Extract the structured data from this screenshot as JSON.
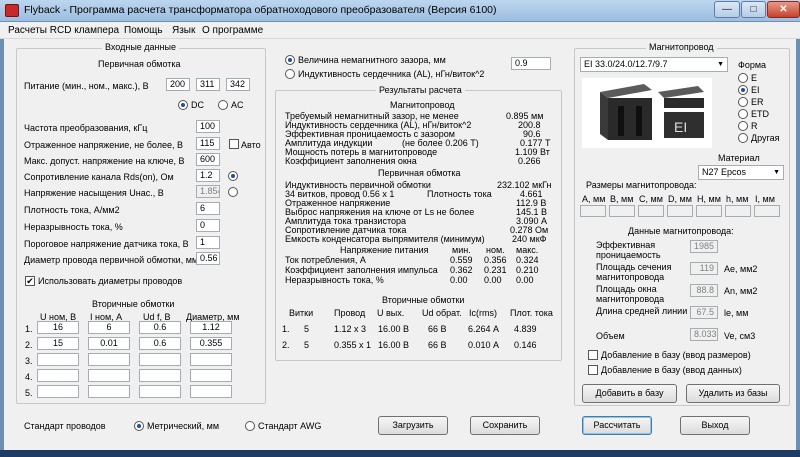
{
  "window": {
    "title": "Flyback - Программа расчета трансформатора обратноходового преобразователя (Версия 6100)",
    "min": "—",
    "max": "□",
    "close": "✕"
  },
  "menu": [
    "Расчеты RCD клампера",
    "Помощь",
    "Язык",
    "О программе"
  ],
  "input": {
    "title": "Входные данные",
    "primary_title": "Первичная обмотка",
    "supply_label": "Питание (мин., ном., макс.), В",
    "supply": [
      "200",
      "311",
      "342"
    ],
    "dc": "DC",
    "ac": "AC",
    "params": [
      {
        "label": "Частота преобразования, кГц",
        "value": "100"
      },
      {
        "label": "Отраженное напряжение, не более, В",
        "value": "115"
      },
      {
        "label": "Макс. допуст. напряжение на ключе, В",
        "value": "600"
      },
      {
        "label": "Сопротивление канала Rds(on), Ом",
        "value": "1.2"
      },
      {
        "label": "Напряжение насыщения Uнас., В",
        "value": "1.854"
      },
      {
        "label": "Плотность тока, А/мм2",
        "value": "6"
      },
      {
        "label": "Неразрывность тока, %",
        "value": "0"
      },
      {
        "label": "Пороговое напряжение датчика тока, В",
        "value": "1"
      },
      {
        "label": "Диаметр провода первичной обмотки, мм",
        "value": "0.56"
      }
    ],
    "auto": "Авто",
    "use_diam": "Использовать диаметры проводов",
    "secondary_title": "Вторичные обмотки",
    "sec_headers": [
      "U ном, В",
      "I ном, А",
      "Ud f, В",
      "Диаметр, мм"
    ],
    "sec_rows": [
      {
        "n": "1.",
        "v": [
          "16",
          "6",
          "0.6",
          "1.12"
        ]
      },
      {
        "n": "2.",
        "v": [
          "15",
          "0.01",
          "0.6",
          "0.355"
        ]
      },
      {
        "n": "3.",
        "v": [
          "",
          "",
          "",
          ""
        ]
      },
      {
        "n": "4.",
        "v": [
          "",
          "",
          "",
          ""
        ]
      },
      {
        "n": "5.",
        "v": [
          "",
          "",
          "",
          ""
        ]
      }
    ]
  },
  "gap": {
    "opt1": "Величина немагнитного зазора, мм",
    "opt2": "Индуктивность сердечника (AL), нГн/виток^2",
    "value": "0.9"
  },
  "results": {
    "title": "Результаты расчета",
    "core_title": "Магнитопровод",
    "core_rows": [
      [
        "Требуемый немагнитный зазор, не менее",
        "",
        "0.895 мм"
      ],
      [
        "Индуктивность сердечника (AL), нГн/виток^2",
        "",
        "200.8"
      ],
      [
        "Эффективная проницаемость с зазором",
        "",
        "90.6"
      ],
      [
        "Амплитуда индукции",
        "(не более 0.206 Т)",
        "0.177 Т"
      ],
      [
        "Мощность потерь в магнитопроводе",
        "",
        "1.109 Вт"
      ],
      [
        "Коэффициент заполнения окна",
        "",
        "0.266"
      ]
    ],
    "prim_title": "Первичная обмотка",
    "prim_rows": [
      [
        "Индуктивность первичной обмотки",
        "",
        "232.102 мкГн"
      ],
      [
        "  34 витков, провод 0.56 x 1",
        "Плотность тока",
        "4.661"
      ],
      [
        "Отраженное напряжение",
        "",
        "112.9 В"
      ],
      [
        "Выброс напряжения на ключе от Ls не более",
        "",
        "145.1 В"
      ],
      [
        "Амплитуда тока транзистора",
        "",
        "3.090 А"
      ],
      [
        "Сопротивление датчика тока",
        "",
        "0.278 Ом"
      ],
      [
        "Емкость конденсатора выпрямителя (минимум)",
        "",
        "240 мкФ"
      ]
    ],
    "sup_title": "Напряжение питания",
    "sup_cols": [
      "мин.",
      "ном.",
      "макс."
    ],
    "sup_rows": [
      {
        "label": "Ток потребления, А",
        "v": [
          "0.559",
          "0.356",
          "0.324"
        ]
      },
      {
        "label": "Коэффициент заполнения импульса",
        "v": [
          "0.362",
          "0.231",
          "0.210"
        ]
      },
      {
        "label": "Неразрывность тока, %",
        "v": [
          "0.00",
          "0.00",
          "0.00"
        ]
      }
    ],
    "sec_title": "Вторичные обмотки",
    "sec_headers": [
      "Витки",
      "Провод",
      "U вых.",
      "Ud обрат.",
      "Ic(rms)",
      "Плот. тока"
    ],
    "sec_rows": [
      {
        "n": "1.",
        "v": [
          "5",
          "1.12 x 3",
          "16.00 В",
          "66 В",
          "6.264 А",
          "4.839"
        ]
      },
      {
        "n": "2.",
        "v": [
          "5",
          "0.355 x 1",
          "16.00 В",
          "66 В",
          "0.010 А",
          "0.146"
        ]
      }
    ]
  },
  "core": {
    "title": "Магнитопровод",
    "selected": "EI 33.0/24.0/12.7/9.7",
    "shape_title": "Форма",
    "shapes": [
      "E",
      "EI",
      "ER",
      "ETD",
      "R",
      "Другая"
    ],
    "shape_selected": 1,
    "material_title": "Материал",
    "material": "N27 Epcos",
    "dims_title": "Размеры магнитопровода:",
    "dims": [
      "A, мм",
      "B, мм",
      "C, мм",
      "D, мм",
      "H, мм",
      "h, мм",
      "I, мм"
    ],
    "data_title": "Данные магнитопровода:",
    "data": [
      {
        "label": "Эффективная проницаемость",
        "value": "1985",
        "unit": ""
      },
      {
        "label": "Площадь сечения магнитопровода",
        "value": "119",
        "unit": "Ae, мм2"
      },
      {
        "label": "Площадь окна магнитопровода",
        "value": "88.8",
        "unit": "An, мм2"
      },
      {
        "label": "Длина средней линии",
        "value": "67.5",
        "unit": "le, мм"
      },
      {
        "label": "Объем",
        "value": "8.033",
        "unit": "Ve, см3"
      }
    ],
    "add_dims": "Добавление в базу (ввод размеров)",
    "add_data": "Добавление в базу (ввод данных)",
    "add_btn": "Добавить в базу",
    "del_btn": "Удалить из базы"
  },
  "bottom": {
    "wire_std": "Стандарт проводов",
    "metric": "Метрический, мм",
    "awg": "Стандарт AWG",
    "load": "Загрузить",
    "save": "Сохранить",
    "calc": "Рассчитать",
    "exit": "Выход"
  }
}
